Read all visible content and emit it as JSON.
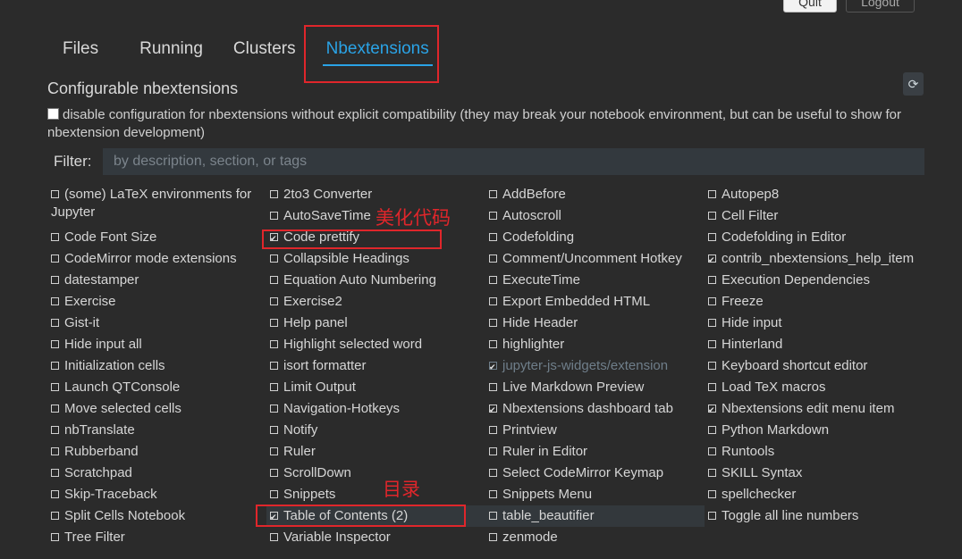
{
  "header": {
    "quit_label": "Quit",
    "logout_label": "Logout"
  },
  "tabs": [
    {
      "label": "Files"
    },
    {
      "label": "Running"
    },
    {
      "label": "Clusters"
    },
    {
      "label": "Nbextensions"
    }
  ],
  "section_title": "Configurable nbextensions",
  "compat_text": "disable configuration for nbextensions without explicit compatibility (they may break your notebook environment, but can be useful to show for nbextension development)",
  "filter": {
    "label": "Filter:",
    "placeholder": "by description, section, or tags"
  },
  "annotations": {
    "code_prettify": "美化代码",
    "toc": "目录"
  },
  "extensions": [
    {
      "label": "(some) LaTeX environments for Jupyter",
      "checked": false
    },
    {
      "label": "2to3 Converter",
      "checked": false
    },
    {
      "label": "AddBefore",
      "checked": false
    },
    {
      "label": "Autopep8",
      "checked": false
    },
    {
      "label": "AutoSaveTime",
      "checked": false
    },
    {
      "label": "Autoscroll",
      "checked": false
    },
    {
      "label": "Cell Filter",
      "checked": false
    },
    {
      "label": "Code Font Size",
      "checked": false
    },
    {
      "label": "Code prettify",
      "checked": true
    },
    {
      "label": "Codefolding",
      "checked": false
    },
    {
      "label": "Codefolding in Editor",
      "checked": false
    },
    {
      "label": "CodeMirror mode extensions",
      "checked": false
    },
    {
      "label": "Collapsible Headings",
      "checked": false
    },
    {
      "label": "Comment/Uncomment Hotkey",
      "checked": false
    },
    {
      "label": "contrib_nbextensions_help_item",
      "checked": true
    },
    {
      "label": "datestamper",
      "checked": false
    },
    {
      "label": "Equation Auto Numbering",
      "checked": false
    },
    {
      "label": "ExecuteTime",
      "checked": false
    },
    {
      "label": "Execution Dependencies",
      "checked": false
    },
    {
      "label": "Exercise",
      "checked": false
    },
    {
      "label": "Exercise2",
      "checked": false
    },
    {
      "label": "Export Embedded HTML",
      "checked": false
    },
    {
      "label": "Freeze",
      "checked": false
    },
    {
      "label": "Gist-it",
      "checked": false
    },
    {
      "label": "Help panel",
      "checked": false
    },
    {
      "label": "Hide Header",
      "checked": false
    },
    {
      "label": "Hide input",
      "checked": false
    },
    {
      "label": "Hide input all",
      "checked": false
    },
    {
      "label": "Highlight selected word",
      "checked": false
    },
    {
      "label": "highlighter",
      "checked": false
    },
    {
      "label": "Hinterland",
      "checked": false
    },
    {
      "label": "Initialization cells",
      "checked": false
    },
    {
      "label": "isort formatter",
      "checked": false
    },
    {
      "label": "jupyter-js-widgets/extension",
      "checked": true,
      "dim": true
    },
    {
      "label": "Keyboard shortcut editor",
      "checked": false
    },
    {
      "label": "Launch QTConsole",
      "checked": false
    },
    {
      "label": "Limit Output",
      "checked": false
    },
    {
      "label": "Live Markdown Preview",
      "checked": false
    },
    {
      "label": "Load TeX macros",
      "checked": false
    },
    {
      "label": "Move selected cells",
      "checked": false
    },
    {
      "label": "Navigation-Hotkeys",
      "checked": false
    },
    {
      "label": "Nbextensions dashboard tab",
      "checked": true
    },
    {
      "label": "Nbextensions edit menu item",
      "checked": true
    },
    {
      "label": "nbTranslate",
      "checked": false
    },
    {
      "label": "Notify",
      "checked": false
    },
    {
      "label": "Printview",
      "checked": false
    },
    {
      "label": "Python Markdown",
      "checked": false
    },
    {
      "label": "Rubberband",
      "checked": false
    },
    {
      "label": "Ruler",
      "checked": false
    },
    {
      "label": "Ruler in Editor",
      "checked": false
    },
    {
      "label": "Runtools",
      "checked": false
    },
    {
      "label": "Scratchpad",
      "checked": false
    },
    {
      "label": "ScrollDown",
      "checked": false
    },
    {
      "label": "Select CodeMirror Keymap",
      "checked": false
    },
    {
      "label": "SKILL Syntax",
      "checked": false
    },
    {
      "label": "Skip-Traceback",
      "checked": false
    },
    {
      "label": "Snippets",
      "checked": false
    },
    {
      "label": "Snippets Menu",
      "checked": false
    },
    {
      "label": "spellchecker",
      "checked": false
    },
    {
      "label": "Split Cells Notebook",
      "checked": false
    },
    {
      "label": "Table of Contents (2)",
      "checked": true,
      "highlight": true
    },
    {
      "label": "table_beautifier",
      "checked": false,
      "highlight": true
    },
    {
      "label": "Toggle all line numbers",
      "checked": false
    },
    {
      "label": "Tree Filter",
      "checked": false
    },
    {
      "label": "Variable Inspector",
      "checked": false
    },
    {
      "label": "zenmode",
      "checked": false
    }
  ]
}
